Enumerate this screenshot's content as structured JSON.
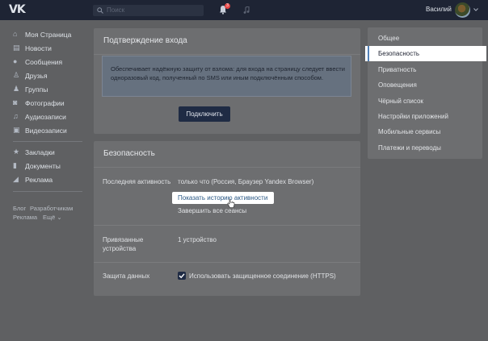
{
  "topbar": {
    "logo": "VK",
    "search_placeholder": "Поиск",
    "notification_count": "3",
    "username": "Василий"
  },
  "left_nav": {
    "items": [
      {
        "label": "Моя Страница",
        "icon": "home-icon"
      },
      {
        "label": "Новости",
        "icon": "news-icon"
      },
      {
        "label": "Сообщения",
        "icon": "messages-icon"
      },
      {
        "label": "Друзья",
        "icon": "friends-icon"
      },
      {
        "label": "Группы",
        "icon": "groups-icon"
      },
      {
        "label": "Фотографии",
        "icon": "photos-icon"
      },
      {
        "label": "Аудиозаписи",
        "icon": "audio-icon"
      },
      {
        "label": "Видеозаписи",
        "icon": "video-icon"
      },
      {
        "label": "Закладки",
        "icon": "bookmarks-icon"
      },
      {
        "label": "Документы",
        "icon": "documents-icon"
      },
      {
        "label": "Реклама",
        "icon": "ads-icon"
      }
    ],
    "footer": {
      "blog": "Блог",
      "developers": "Разработчикам",
      "ads": "Реклама",
      "more": "Ещё ⌄"
    }
  },
  "login_confirm": {
    "title": "Подтверждение входа",
    "info": "Обеспечивает надёжную защиту от взлома: для входа на страницу следует ввести одноразовый код, полученный по SMS или иным подключённым способом.",
    "button": "Подключить"
  },
  "security": {
    "title": "Безопасность",
    "last_activity_label": "Последняя активность",
    "last_activity_value": "только что (Россия, Браузер Yandex Browser)",
    "show_history_link": "Показать историю активности",
    "end_sessions_link": "Завершить все сеансы",
    "linked_devices_label": "Привязанные устройства",
    "linked_devices_value": "1 устройство",
    "data_protection_label": "Защита данных",
    "https_label": "Использовать защищенное соединение (HTTPS)",
    "https_checked": true
  },
  "settings_menu": {
    "items": [
      "Общее",
      "Безопасность",
      "Приватность",
      "Оповещения",
      "Чёрный список",
      "Настройки приложений",
      "Мобильные сервисы",
      "Платежи и переводы"
    ],
    "active": "Безопасность"
  },
  "colors": {
    "topbar": "#1e2434",
    "accent": "#5181b8",
    "button": "#1f2b44"
  }
}
